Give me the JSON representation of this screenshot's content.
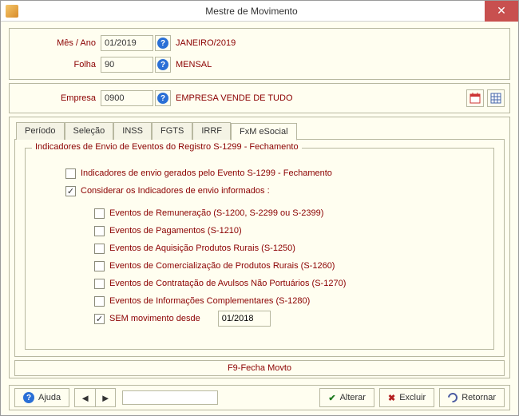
{
  "window": {
    "title": "Mestre de Movimento"
  },
  "header": {
    "mes_ano_label": "Mês / Ano",
    "mes_ano_value": "01/2019",
    "mes_ano_desc": "JANEIRO/2019",
    "folha_label": "Folha",
    "folha_value": "90",
    "folha_desc": "MENSAL",
    "empresa_label": "Empresa",
    "empresa_value": "0900",
    "empresa_desc": "EMPRESA VENDE DE TUDO"
  },
  "tabs": {
    "items": [
      {
        "label": "Período"
      },
      {
        "label": "Seleção"
      },
      {
        "label": "INSS"
      },
      {
        "label": "FGTS"
      },
      {
        "label": "IRRF"
      },
      {
        "label": "FxM eSocial"
      }
    ]
  },
  "fxm": {
    "group_title": "Indicadores de Envio de Eventos do Registro S-1299 - Fechamento",
    "opt_gerados": "Indicadores de envio gerados pelo Evento S-1299 - Fechamento",
    "opt_considerar": "Considerar os Indicadores de envio informados :",
    "sub": {
      "remuneracao": "Eventos de Remuneração (S-1200, S-2299 ou S-2399)",
      "pagamentos": "Eventos de Pagamentos (S-1210)",
      "aquisicao": "Eventos de Aquisição Produtos Rurais (S-1250)",
      "comercializacao": "Eventos de Comercialização de Produtos Rurais (S-1260)",
      "avulsos": "Eventos de Contratação de Avulsos Não Portuários (S-1270)",
      "complementares": "Eventos de Informações Complementares (S-1280)",
      "sem_movimento": "SEM movimento desde",
      "sem_movimento_value": "01/2018"
    }
  },
  "status": {
    "text": "F9-Fecha Movto"
  },
  "bottom": {
    "ajuda": "Ajuda",
    "alterar": "Alterar",
    "excluir": "Excluir",
    "retornar": "Retornar"
  }
}
